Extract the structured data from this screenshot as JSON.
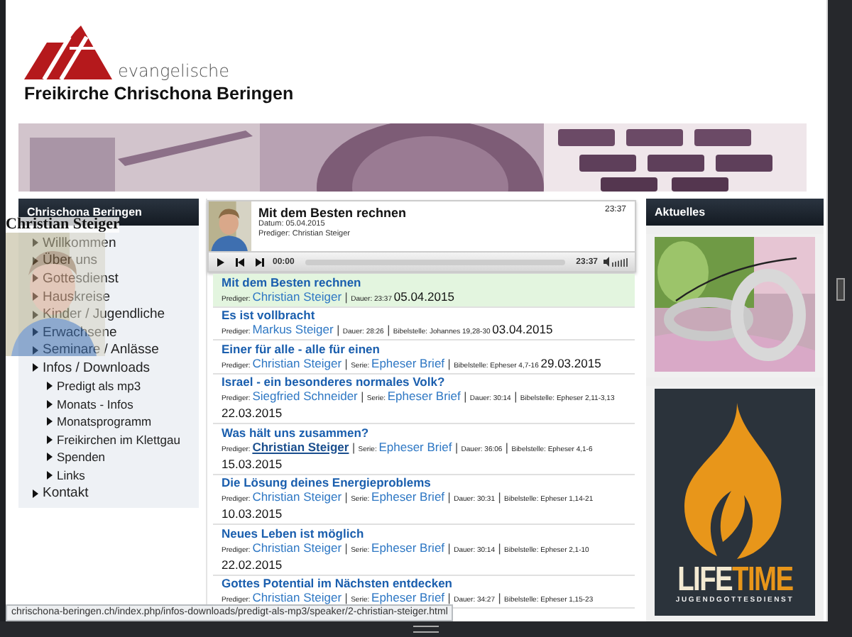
{
  "browser": {
    "status_url": "chrischona-beringen.ch/index.php/infos-downloads/predigt-als-mp3/speaker/2-christian-steiger.html"
  },
  "logo": {
    "tagline": "evangelische",
    "name": "Freikirche Chrischona Beringen"
  },
  "banner": {
    "kind": "picture"
  },
  "nav": {
    "title": "Chrischona Beringen",
    "items": [
      {
        "label": "Willkommen"
      },
      {
        "label": "Über uns"
      },
      {
        "label": "Gottesdienst"
      },
      {
        "label": "Hauskreise"
      },
      {
        "label": "Kinder / Jugendliche"
      },
      {
        "label": "Erwachsene"
      },
      {
        "label": "Seminare / Anlässe"
      },
      {
        "label": "Infos / Downloads",
        "children": [
          {
            "label": "Predigt als mp3"
          },
          {
            "label": "Monats - Infos"
          },
          {
            "label": "Monatsprogramm"
          },
          {
            "label": "Freikirchen im Klettgau"
          },
          {
            "label": "Spenden"
          },
          {
            "label": "Links"
          }
        ]
      },
      {
        "label": "Kontakt"
      }
    ]
  },
  "hover_card": {
    "name": "Christian Steiger"
  },
  "player": {
    "title": "Mit dem Besten rechnen",
    "duration": "23:37",
    "date_line": "Datum: 05.04.2015",
    "speaker_line": "Prediger: Christian Steiger",
    "time_current": "00:00",
    "time_total": "23:37",
    "level": 0
  },
  "sermons": {
    "separator": "|",
    "items": [
      {
        "title": "Mit dem Besten rechnen",
        "selected": true,
        "date": "05.04.2015",
        "fields": [
          {
            "kind": "link",
            "label": "Prediger:",
            "value": "Christian Steiger",
            "hovered": false
          },
          {
            "kind": "plain",
            "label": "Dauer:",
            "value": "23:37"
          }
        ]
      },
      {
        "title": "Es ist vollbracht",
        "selected": false,
        "date": "03.04.2015",
        "fields": [
          {
            "kind": "link",
            "label": "Prediger:",
            "value": "Markus Steiger",
            "hovered": false
          },
          {
            "kind": "plain",
            "label": "Dauer:",
            "value": "28:26"
          },
          {
            "kind": "plain",
            "label": "Bibelstelle:",
            "value": "Johannes 19,28-30"
          }
        ]
      },
      {
        "title": "Einer für alle - alle für einen",
        "selected": false,
        "date": "29.03.2015",
        "fields": [
          {
            "kind": "link",
            "label": "Prediger:",
            "value": "Christian Steiger",
            "hovered": false
          },
          {
            "kind": "link",
            "label": "Serie:",
            "value": "Epheser Brief",
            "hovered": false
          },
          {
            "kind": "plain",
            "label": "Bibelstelle:",
            "value": "Epheser 4,7-16"
          }
        ]
      },
      {
        "title": "Israel - ein besonderes normales Volk?",
        "selected": false,
        "date": "22.03.2015",
        "fields": [
          {
            "kind": "link",
            "label": "Prediger:",
            "value": "Siegfried Schneider",
            "hovered": false
          },
          {
            "kind": "link",
            "label": "Serie:",
            "value": "Epheser Brief",
            "hovered": false
          },
          {
            "kind": "plain",
            "label": "Dauer:",
            "value": "30:14"
          },
          {
            "kind": "plain",
            "label": "Bibelstelle:",
            "value": "Epheser 2,11-3,13"
          }
        ]
      },
      {
        "title": "Was hält uns zusammen?",
        "selected": false,
        "date": "15.03.2015",
        "fields": [
          {
            "kind": "link",
            "label": "Prediger:",
            "value": "Christian Steiger",
            "hovered": true
          },
          {
            "kind": "link",
            "label": "Serie:",
            "value": "Epheser Brief",
            "hovered": false
          },
          {
            "kind": "plain",
            "label": "Dauer:",
            "value": "36:06"
          },
          {
            "kind": "plain",
            "label": "Bibelstelle:",
            "value": "Epheser 4,1-6"
          }
        ]
      },
      {
        "title": "Die Lösung deines Energieproblems",
        "selected": false,
        "date": "10.03.2015",
        "fields": [
          {
            "kind": "link",
            "label": "Prediger:",
            "value": "Christian Steiger",
            "hovered": false
          },
          {
            "kind": "link",
            "label": "Serie:",
            "value": "Epheser Brief",
            "hovered": false
          },
          {
            "kind": "plain",
            "label": "Dauer:",
            "value": "30:31"
          },
          {
            "kind": "plain",
            "label": "Bibelstelle:",
            "value": "Epheser 1,14-21"
          }
        ]
      },
      {
        "title": "Neues Leben ist möglich",
        "selected": false,
        "date": "22.02.2015",
        "fields": [
          {
            "kind": "link",
            "label": "Prediger:",
            "value": "Christian Steiger",
            "hovered": false
          },
          {
            "kind": "link",
            "label": "Serie:",
            "value": "Epheser Brief",
            "hovered": false
          },
          {
            "kind": "plain",
            "label": "Dauer:",
            "value": "30:14"
          },
          {
            "kind": "plain",
            "label": "Bibelstelle:",
            "value": "Epheser 2,1-10"
          }
        ]
      },
      {
        "title": "Gottes Potential im Nächsten entdecken",
        "selected": false,
        "fields": [
          {
            "kind": "link",
            "label": "Prediger:",
            "value": "Christian Steiger",
            "hovered": false
          },
          {
            "kind": "link",
            "label": "Serie:",
            "value": "Epheser Brief",
            "hovered": false
          },
          {
            "kind": "plain",
            "label": "Dauer:",
            "value": "34:27"
          },
          {
            "kind": "plain",
            "label": "Bibelstelle:",
            "value": "Epheser 1,15-23"
          }
        ]
      }
    ]
  },
  "sidebar": {
    "title": "Aktuelles",
    "cards": [
      {
        "kind": "picture"
      },
      {
        "kind": "logo",
        "title_parts": [
          "LIFE",
          "TIME"
        ],
        "subtitle": "JUGENDGOTTESDIENST"
      }
    ]
  }
}
